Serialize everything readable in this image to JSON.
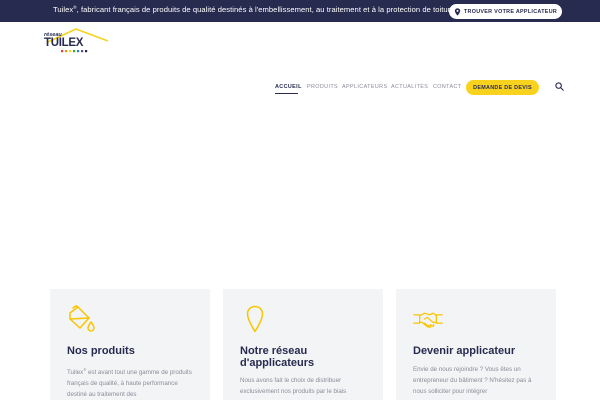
{
  "topbar": {
    "brand": "Tuilex",
    "brand_mark": "®",
    "tagline": ", fabricant français de produits de qualité destinés à l'embellissement, au traitement et à la protection de toiture.",
    "locator_label": "TROUVER VOTRE APPLICATEUR"
  },
  "logo": {
    "top_text": "réseau",
    "name": "TUILEX"
  },
  "nav": {
    "items": [
      "ACCUEIL",
      "PRODUITS",
      "APPLICATEURS",
      "ACTUALITÉS",
      "CONTACT"
    ],
    "active": "ACCUEIL",
    "quote_label": "DEMANDE DE DEVIS"
  },
  "cards": [
    {
      "title": "Nos produits",
      "text_brand": "Tuilex",
      "text_mark": "®",
      "text": " est avant tout une gamme de produits français de qualité, à haute performance destiné au traitement des",
      "icon": "paint-bucket-icon"
    },
    {
      "title": "Notre réseau d'applicateurs",
      "text": "Nous avons fait le choix de distribuer exclusivement nos produits par le biais",
      "icon": "location-pin-icon"
    },
    {
      "title": "Devenir applicateur",
      "text": "Envie de nous rejoindre ? Vous êtes un entrepreneur du bâtiment ? N'hésitez pas à nous solliciter pour intégrer",
      "icon": "handshake-icon"
    }
  ],
  "colors": {
    "navy": "#272b4f",
    "yellow": "#f9d21e",
    "card_bg": "#f3f4f6",
    "muted": "#8a8c99"
  }
}
